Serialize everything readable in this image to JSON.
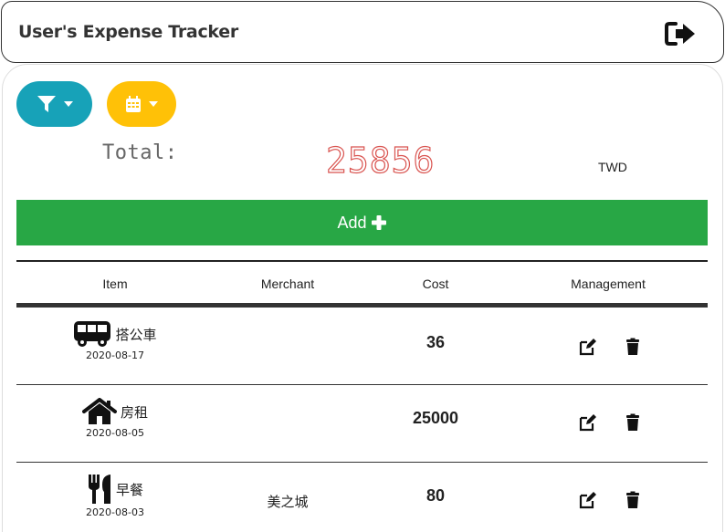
{
  "header": {
    "title": "User's Expense Tracker",
    "logout_icon": "sign-out-icon"
  },
  "toolbar": {
    "filter_icon": "filter-icon",
    "calendar_icon": "calendar-icon",
    "filter_color": "#17a2b8",
    "date_color": "#ffc107"
  },
  "summary": {
    "total_label": "Total:",
    "total_value": "25856",
    "currency": "TWD"
  },
  "add_button": {
    "label": "Add",
    "color": "#28a745"
  },
  "table": {
    "headers": [
      "Item",
      "Merchant",
      "Cost",
      "Management"
    ],
    "rows": [
      {
        "icon": "bus-icon",
        "name": "搭公車",
        "date": "2020-08-17",
        "merchant": "",
        "cost": "36"
      },
      {
        "icon": "home-icon",
        "name": "房租",
        "date": "2020-08-05",
        "merchant": "",
        "cost": "25000"
      },
      {
        "icon": "utensils-icon",
        "name": "早餐",
        "date": "2020-08-03",
        "merchant": "美之城",
        "cost": "80"
      }
    ]
  }
}
